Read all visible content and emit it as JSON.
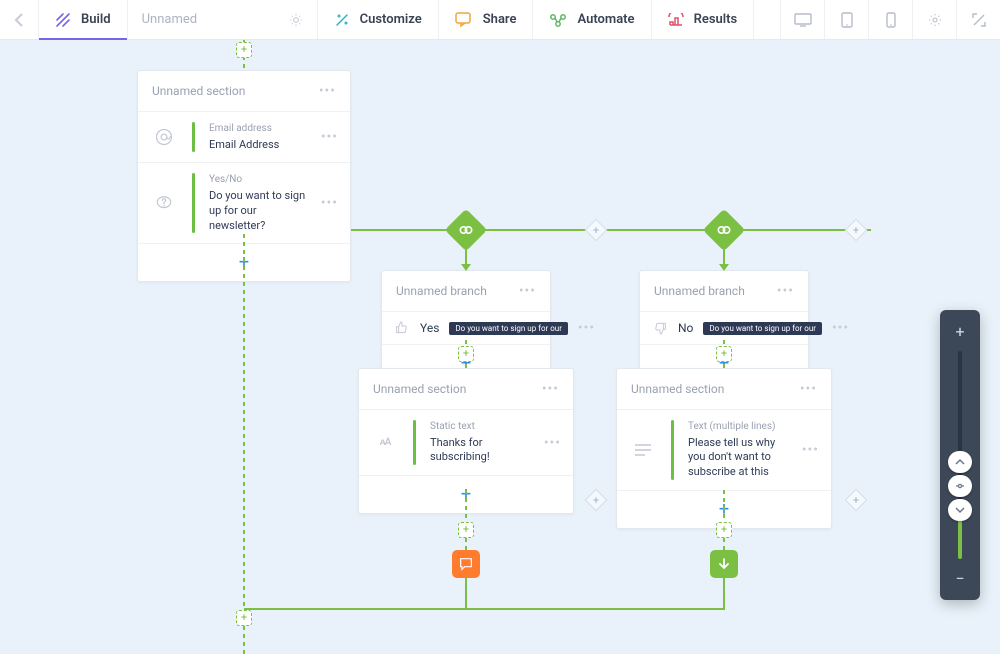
{
  "nav": {
    "build": "Build",
    "title": "Unnamed",
    "customize": "Customize",
    "share": "Share",
    "automate": "Automate",
    "results": "Results"
  },
  "section1": {
    "title": "Unnamed section",
    "rows": [
      {
        "type": "Email address",
        "label": "Email Address"
      },
      {
        "type": "Yes/No",
        "label": "Do you want to sign up for our newsletter?"
      }
    ]
  },
  "branchLeft": {
    "title": "Unnamed branch",
    "answer": "Yes",
    "pill": "Do you want to sign up for our"
  },
  "branchRight": {
    "title": "Unnamed branch",
    "answer": "No",
    "pill": "Do you want to sign up for our"
  },
  "sectionLeft": {
    "title": "Unnamed section",
    "row": {
      "type": "Static text",
      "label": "Thanks for subscribing!"
    }
  },
  "sectionRight": {
    "title": "Unnamed section",
    "row": {
      "type": "Text (multiple lines)",
      "label": "Please tell us why you don't want to subscribe at this"
    }
  }
}
